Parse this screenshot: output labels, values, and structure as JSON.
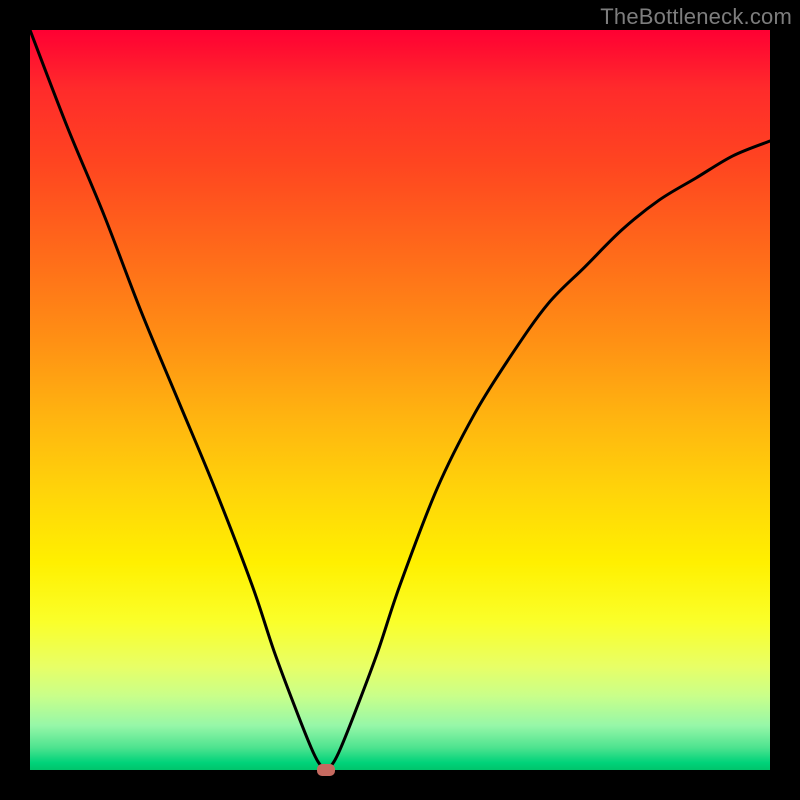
{
  "watermark": "TheBottleneck.com",
  "chart_data": {
    "type": "line",
    "title": "",
    "xlabel": "",
    "ylabel": "",
    "xlim": [
      0,
      100
    ],
    "ylim": [
      0,
      100
    ],
    "grid": false,
    "legend": false,
    "background_gradient": {
      "direction": "vertical",
      "stops": [
        {
          "pos": 0,
          "color": "#ff0033"
        },
        {
          "pos": 18,
          "color": "#ff4520"
        },
        {
          "pos": 42,
          "color": "#ff9014"
        },
        {
          "pos": 62,
          "color": "#ffd30a"
        },
        {
          "pos": 80,
          "color": "#faff2a"
        },
        {
          "pos": 94,
          "color": "#96f7a8"
        },
        {
          "pos": 100,
          "color": "#00c46b"
        }
      ]
    },
    "series": [
      {
        "name": "bottleneck-curve",
        "color": "#000000",
        "x": [
          0,
          5,
          10,
          15,
          20,
          25,
          30,
          33,
          36,
          38,
          39,
          40,
          41,
          42,
          44,
          47,
          50,
          55,
          60,
          65,
          70,
          75,
          80,
          85,
          90,
          95,
          100
        ],
        "y": [
          100,
          87,
          75,
          62,
          50,
          38,
          25,
          16,
          8,
          3,
          1,
          0,
          1,
          3,
          8,
          16,
          25,
          38,
          48,
          56,
          63,
          68,
          73,
          77,
          80,
          83,
          85
        ]
      }
    ],
    "marker": {
      "x": 40,
      "y": 0,
      "color": "#c66a60"
    }
  }
}
